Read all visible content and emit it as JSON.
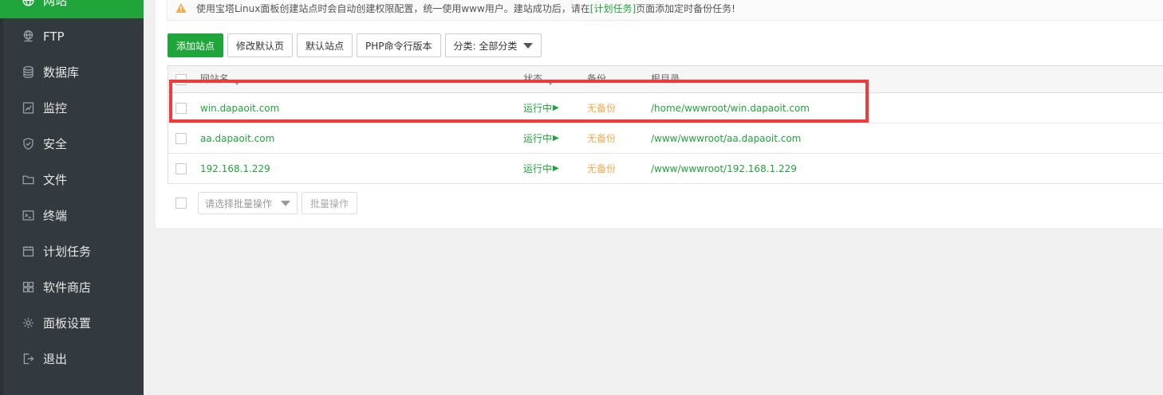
{
  "sidebar": {
    "items": [
      {
        "label": "网站",
        "icon": "globe-icon",
        "active": true
      },
      {
        "label": "FTP",
        "icon": "network-icon"
      },
      {
        "label": "数据库",
        "icon": "database-icon"
      },
      {
        "label": "监控",
        "icon": "monitor-icon"
      },
      {
        "label": "安全",
        "icon": "shield-icon"
      },
      {
        "label": "文件",
        "icon": "folder-icon"
      },
      {
        "label": "终端",
        "icon": "terminal-icon"
      },
      {
        "label": "计划任务",
        "icon": "calendar-icon"
      },
      {
        "label": "软件商店",
        "icon": "grid-icon"
      },
      {
        "label": "面板设置",
        "icon": "gear-icon"
      },
      {
        "label": "退出",
        "icon": "logout-icon"
      }
    ]
  },
  "notice": {
    "text_before": "使用宝塔Linux面板创建站点时会自动创建权限配置，统一使用www用户。建站成功后，请在",
    "link": "[计划任务]",
    "text_after": "页面添加定时备份任务!"
  },
  "toolbar": {
    "add_site": "添加站点",
    "edit_default_page": "修改默认页",
    "default_site": "默认站点",
    "php_cli": "PHP命令行版本",
    "category": "分类: 全部分类"
  },
  "table": {
    "headers": {
      "name": "网站名",
      "status": "状态",
      "backup": "备份",
      "root": "根目录"
    },
    "rows": [
      {
        "name": "win.dapaoit.com",
        "status": "运行中",
        "backup": "无备份",
        "root": "/home/wwwroot/win.dapaoit.com"
      },
      {
        "name": "aa.dapaoit.com",
        "status": "运行中",
        "backup": "无备份",
        "root": "/www/wwwroot/aa.dapaoit.com"
      },
      {
        "name": "192.168.1.229",
        "status": "运行中",
        "backup": "无备份",
        "root": "/www/wwwroot/192.168.1.229"
      }
    ]
  },
  "batch": {
    "placeholder": "请选择批量操作",
    "button": "批量操作"
  },
  "colors": {
    "sidebar_bg": "#333a3f",
    "accent_green": "#20a53a",
    "backup_orange": "#f0ad4e",
    "highlight_red": "#f13b3b"
  }
}
